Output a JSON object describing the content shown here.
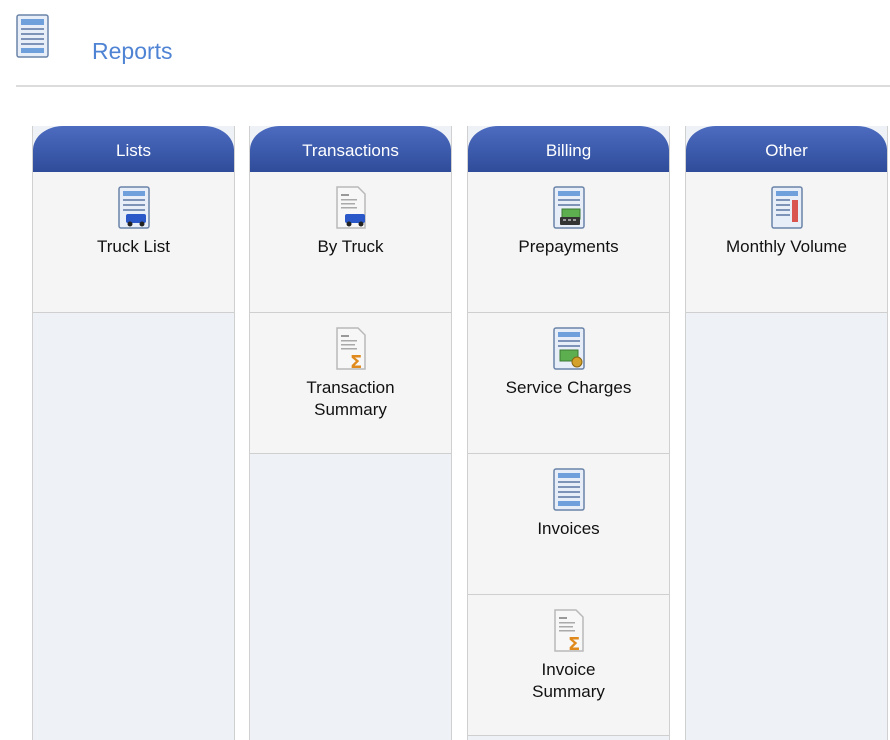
{
  "header": {
    "title": "Reports",
    "icon": "report-document-icon"
  },
  "columns": [
    {
      "title": "Lists",
      "items": [
        {
          "label": "Truck List",
          "icon": "truck-list-icon"
        }
      ]
    },
    {
      "title": "Transactions",
      "items": [
        {
          "label": "By Truck",
          "icon": "transaction-truck-icon"
        },
        {
          "label": "Transaction\nSummary",
          "icon": "transaction-summary-icon"
        }
      ]
    },
    {
      "title": "Billing",
      "items": [
        {
          "label": "Prepayments",
          "icon": "prepayments-icon"
        },
        {
          "label": "Service Charges",
          "icon": "service-charges-icon"
        },
        {
          "label": "Invoices",
          "icon": "invoices-icon"
        },
        {
          "label": "Invoice\nSummary",
          "icon": "invoice-summary-icon"
        }
      ]
    },
    {
      "title": "Other",
      "items": [
        {
          "label": "Monthly Volume",
          "icon": "monthly-volume-icon"
        }
      ]
    }
  ],
  "colors": {
    "header_text": "#4f83d4",
    "column_head": "#2f4c9a",
    "panel_bg": "#eef2f6"
  }
}
